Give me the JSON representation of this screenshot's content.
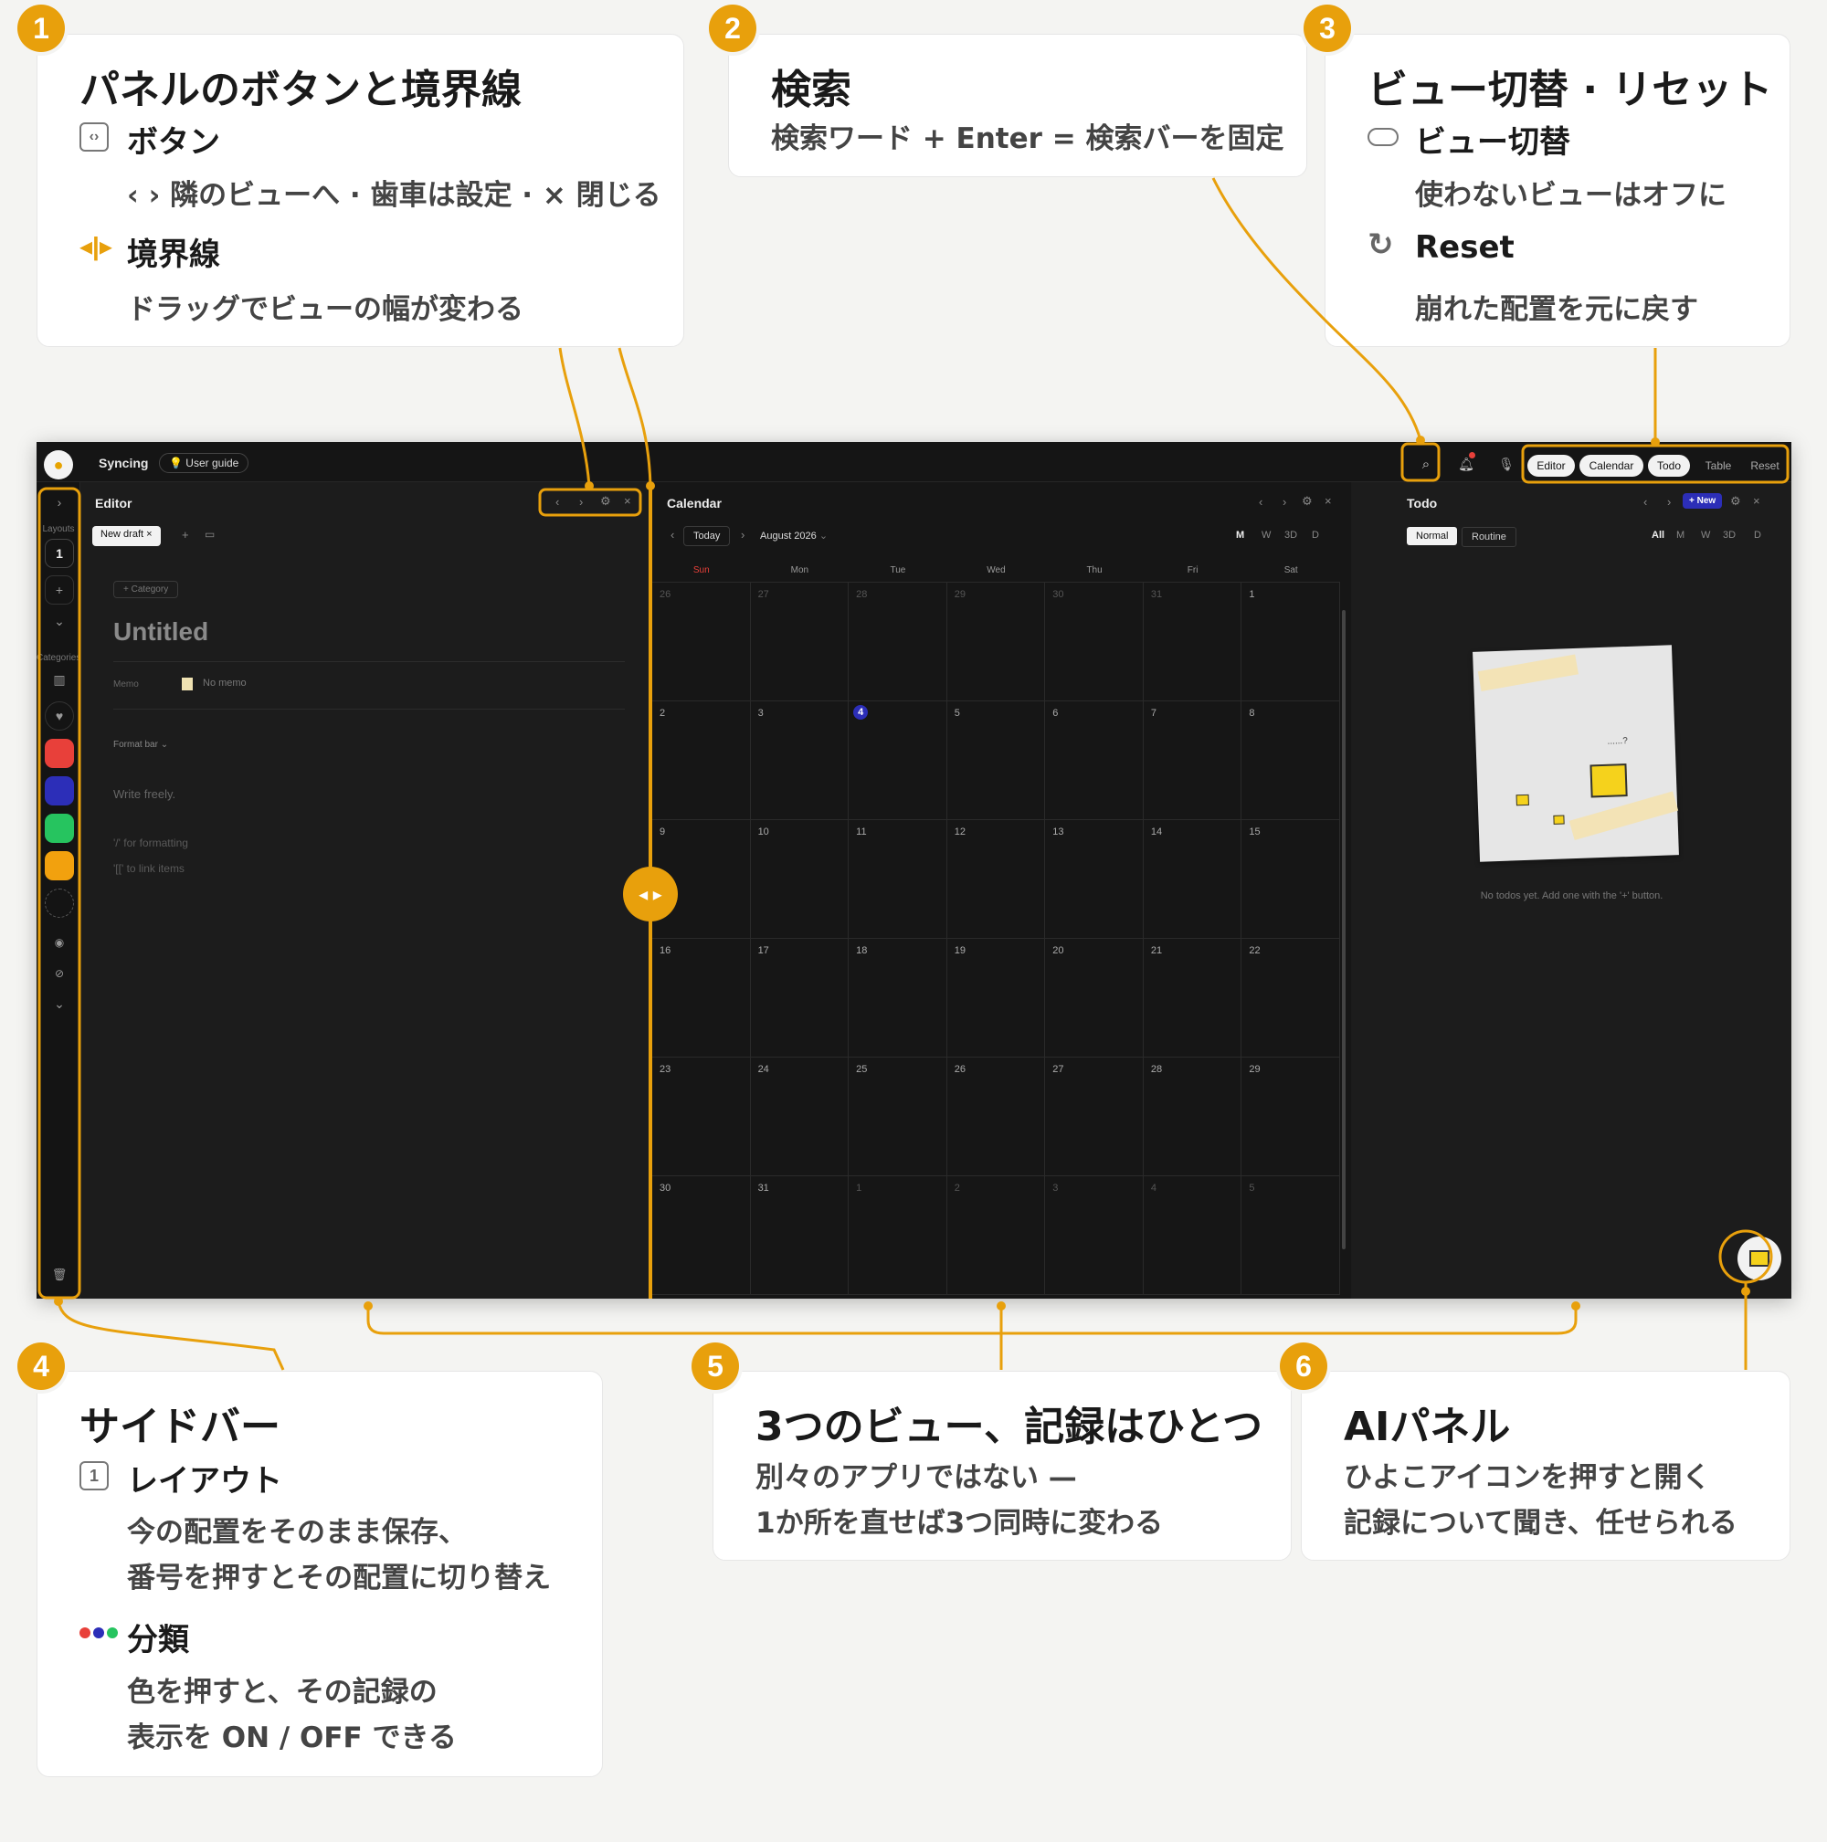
{
  "callouts": {
    "c1": {
      "num": "1",
      "title": "パネルのボタンと境界線",
      "sub1": "ボタン",
      "text1": "‹ › 隣のビューへ · 歯車は設定 · × 閉じる",
      "sub2": "境界線",
      "text2": "ドラッグでビューの幅が変わる"
    },
    "c2": {
      "num": "2",
      "title": "検索",
      "text1": "検索ワード + Enter = 検索バーを固定"
    },
    "c3": {
      "num": "3",
      "title": "ビュー切替 · リセット",
      "sub1": "ビュー切替",
      "text1": "使わないビューはオフに",
      "sub2": "Reset",
      "text2": "崩れた配置を元に戻す"
    },
    "c4": {
      "num": "4",
      "title": "サイドバー",
      "sub1": "レイアウト",
      "text1a": "今の配置をそのまま保存、",
      "text1b": "番号を押すとその配置に切り替え",
      "sub2": "分類",
      "text2a": "色を押すと、その記録の",
      "text2b": "表示を ON / OFF できる",
      "icon1": "1"
    },
    "c5": {
      "num": "5",
      "title": "3つのビュー、記録はひとつ",
      "text1": "別々のアプリではない —",
      "text2": "1か所を直せば3つ同時に変わる"
    },
    "c6": {
      "num": "6",
      "title": "AIパネル",
      "text1": "ひよこアイコンを押すと開く",
      "text2": "記録について聞き、任せられる"
    }
  },
  "app": {
    "topbar": {
      "app_name": "Syncing",
      "guide": "User guide",
      "views": [
        "Editor",
        "Calendar",
        "Todo",
        "Table",
        "Reset"
      ]
    },
    "sidebar": {
      "layouts_label": "Layouts",
      "layout_num": "1",
      "categories_label": "Categories",
      "colors": [
        "#e8403a",
        "#2c2eb8",
        "#26c45f",
        "#f2a10e"
      ]
    },
    "editor": {
      "title": "Editor",
      "tab": "New draft ×",
      "category_btn": "+ Category",
      "doc_title": "Untitled",
      "memo_label": "Memo",
      "memo_value": "No memo",
      "format_bar": "Format bar",
      "placeholder": "Write freely.",
      "hint1": "'/' for formatting",
      "hint2": "'[[' to link items"
    },
    "calendar": {
      "title": "Calendar",
      "today": "Today",
      "month": "August 2026",
      "modes": [
        "M",
        "W",
        "3D",
        "D"
      ],
      "weekdays": [
        "Sun",
        "Mon",
        "Tue",
        "Wed",
        "Thu",
        "Fri",
        "Sat"
      ],
      "weeks": [
        [
          "26",
          "27",
          "28",
          "29",
          "30",
          "31",
          "1"
        ],
        [
          "2",
          "3",
          "4",
          "5",
          "6",
          "7",
          "8"
        ],
        [
          "9",
          "10",
          "11",
          "12",
          "13",
          "14",
          "15"
        ],
        [
          "16",
          "17",
          "18",
          "19",
          "20",
          "21",
          "22"
        ],
        [
          "23",
          "24",
          "25",
          "26",
          "27",
          "28",
          "29"
        ],
        [
          "30",
          "31",
          "1",
          "2",
          "3",
          "4",
          "5"
        ]
      ],
      "today_date": "4"
    },
    "todo": {
      "title": "Todo",
      "new_btn": "+ New",
      "tabs": [
        "Normal",
        "Routine"
      ],
      "filters": [
        "All",
        "M",
        "W",
        "3D",
        "D"
      ],
      "empty": "No todos yet. Add one with the '+' button.",
      "question": "......?"
    }
  },
  "colors": {
    "accent": "#e8a00c",
    "today_circle": "#2c2eb8",
    "sun": "#e8403a"
  }
}
